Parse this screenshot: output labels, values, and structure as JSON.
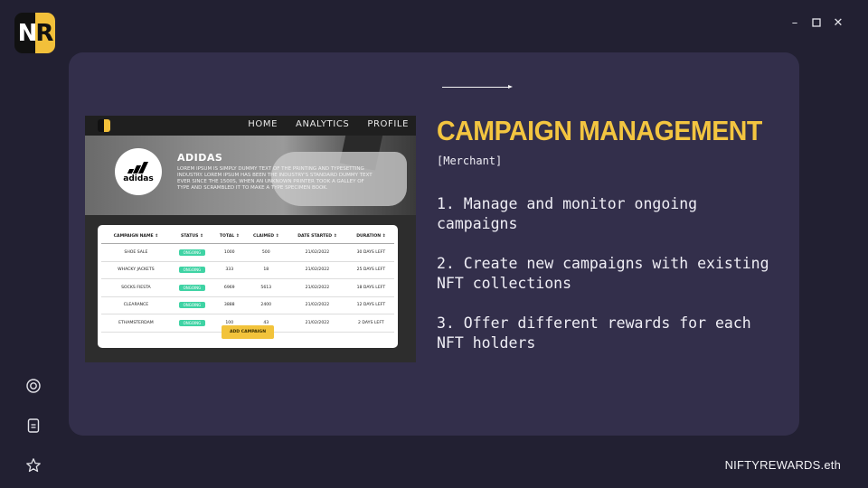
{
  "app": {
    "logo_text_left": "N",
    "logo_text_right": "R",
    "window_controls": {
      "minimize": "–",
      "maximize": "□",
      "close": "✕"
    },
    "footer_brand": "NIFTYREWARDS.eth"
  },
  "sidebar": {
    "icons": [
      "target-icon",
      "document-icon",
      "star-icon"
    ]
  },
  "slide": {
    "title": "CAMPAIGN MANAGEMENT",
    "subtitle": "[Merchant]",
    "points": [
      "1. Manage and monitor ongoing campaigns",
      "2. Create new campaigns with existing NFT collections",
      "3. Offer different rewards for each NFT holders"
    ]
  },
  "mockup": {
    "nav_links": [
      "HOME",
      "ANALYTICS",
      "PROFILE"
    ],
    "brand_name": "ADIDAS",
    "brand_logo_word": "adidas",
    "brand_description": "LOREM IPSUM IS SIMPLY DUMMY TEXT OF THE PRINTING AND TYPESETTING INDUSTRY. LOREM IPSUM HAS BEEN THE INDUSTRY'S STANDARD DUMMY TEXT EVER SINCE THE 1500S, WHEN AN UNKNOWN PRINTER TOOK A GALLEY OF TYPE AND SCRAMBLED IT TO MAKE A TYPE SPECIMEN BOOK.",
    "table": {
      "columns": [
        "CAMPAIGN NAME ⇕",
        "STATUS ⇕",
        "TOTAL ⇕",
        "CLAIMED ⇕",
        "DATE STARTED ⇕",
        "DURATION ⇕"
      ],
      "rows": [
        [
          "SHOE SALE",
          "ONGOING",
          "1000",
          "500",
          "21/02/2022",
          "30 DAYS LEFT"
        ],
        [
          "WHACKY JACKETS",
          "ONGOING",
          "333",
          "18",
          "21/02/2022",
          "25 DAYS LEFT"
        ],
        [
          "SOCKS FIESTA",
          "ONGOING",
          "6969",
          "5613",
          "21/02/2022",
          "18 DAYS LEFT"
        ],
        [
          "CLEARANCE",
          "ONGOING",
          "3888",
          "2400",
          "21/02/2022",
          "12 DAYS LEFT"
        ],
        [
          "ETHAMSTERDAM",
          "ONGOING",
          "100",
          "43",
          "21/02/2022",
          "2 DAYS LEFT"
        ]
      ]
    },
    "add_button": "ADD CAMPAIGN"
  }
}
